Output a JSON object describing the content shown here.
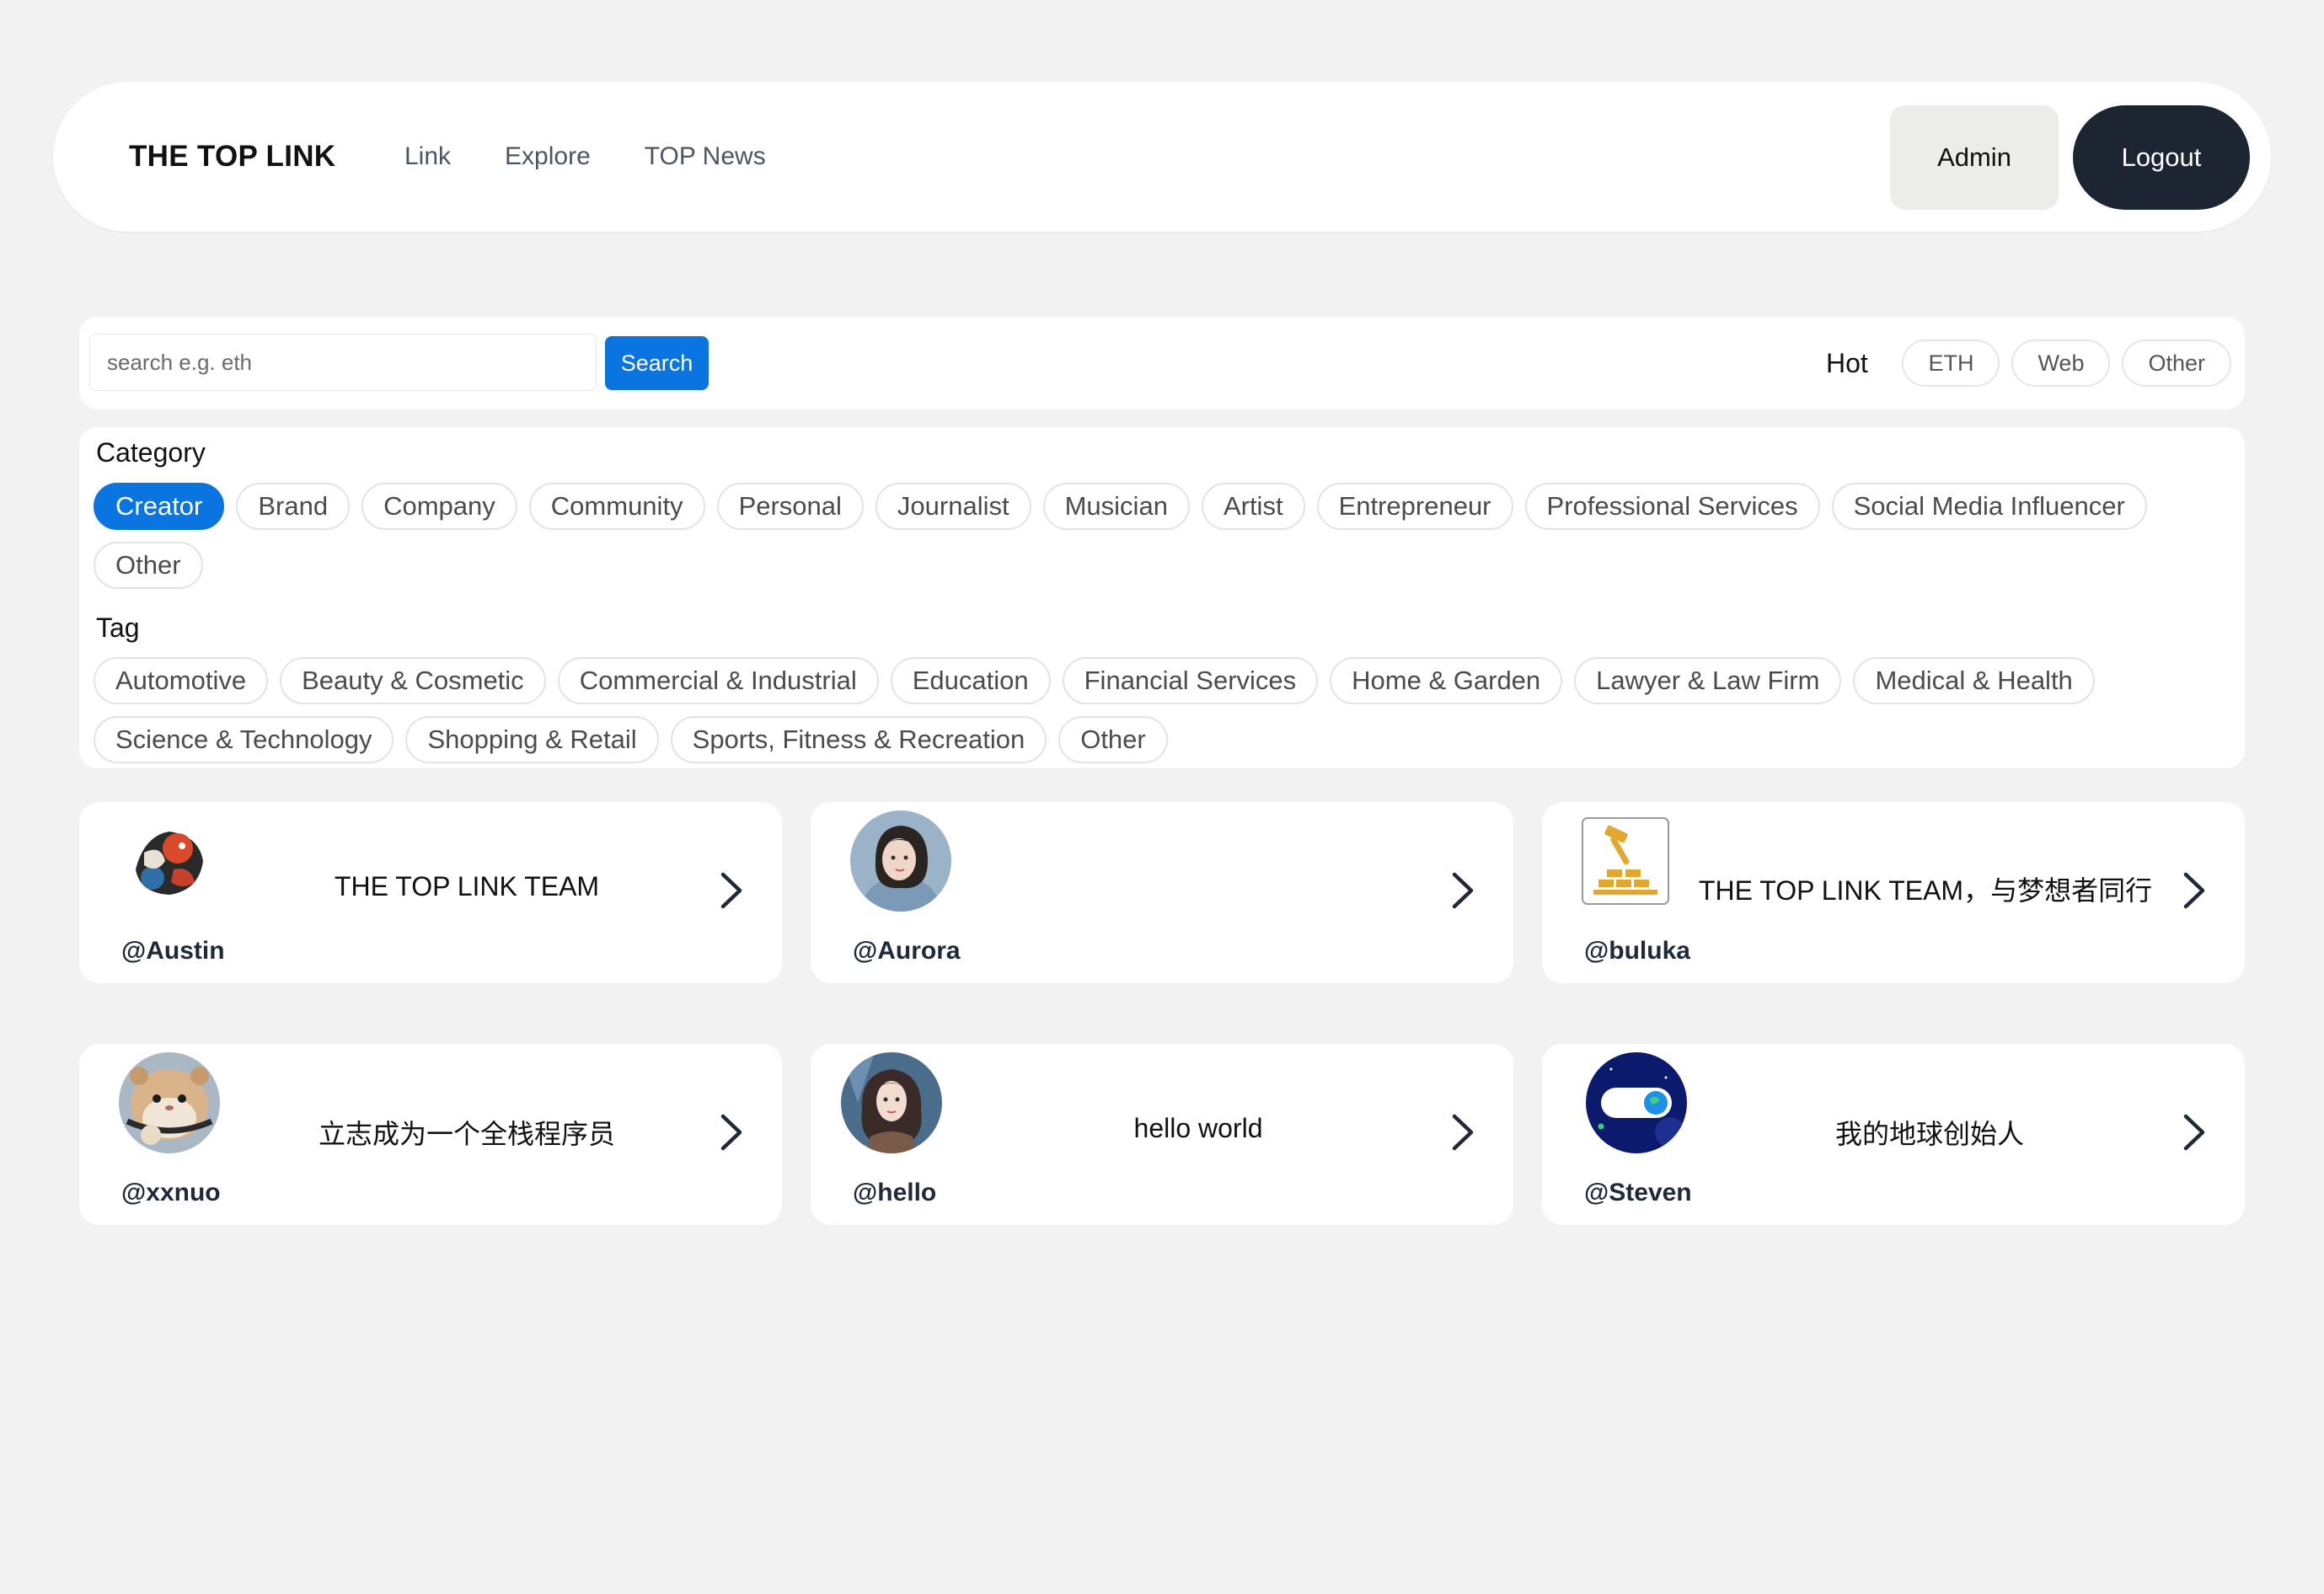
{
  "header": {
    "brand": "THE TOP LINK",
    "nav": [
      "Link",
      "Explore",
      "TOP News"
    ],
    "admin_label": "Admin",
    "logout_label": "Logout"
  },
  "search": {
    "placeholder": "search e.g. eth",
    "button_label": "Search",
    "hot_label": "Hot",
    "hot_tags": [
      "ETH",
      "Web",
      "Other"
    ]
  },
  "filters": {
    "category_label": "Category",
    "categories": [
      "Creator",
      "Brand",
      "Company",
      "Community",
      "Personal",
      "Journalist",
      "Musician",
      "Artist",
      "Entrepreneur",
      "Professional Services",
      "Social Media Influencer",
      "Other"
    ],
    "active_category": "Creator",
    "tag_label": "Tag",
    "tags": [
      "Automotive",
      "Beauty & Cosmetic",
      "Commercial & Industrial",
      "Education",
      "Financial Services",
      "Home & Garden",
      "Lawyer & Law Firm",
      "Medical & Health",
      "Science & Technology",
      "Shopping & Retail",
      "Sports, Fitness & Recreation",
      "Other"
    ]
  },
  "colors": {
    "accent": "#0a74e0",
    "logout_bg": "#1d2432",
    "admin_bg": "#ecece8",
    "page_bg": "#f2f2f2"
  },
  "cards": [
    {
      "handle": "@Austin",
      "bio": "THE TOP LINK TEAM",
      "avatar": "illustrated-koi-avatar"
    },
    {
      "handle": "@Aurora",
      "bio": "",
      "avatar": "portrait-photo-avatar"
    },
    {
      "handle": "@buluka",
      "bio": "THE TOP LINK TEAM，与梦想者同行",
      "avatar": "builder-hammer-avatar"
    },
    {
      "handle": "@xxnuo",
      "bio": "立志成为一个全栈程序员",
      "avatar": "hamster-avatar"
    },
    {
      "handle": "@hello",
      "bio": "hello world",
      "avatar": "portrait-art-avatar"
    },
    {
      "handle": "@Steven",
      "bio": "我的地球创始人",
      "avatar": "earth-toggle-avatar"
    }
  ]
}
